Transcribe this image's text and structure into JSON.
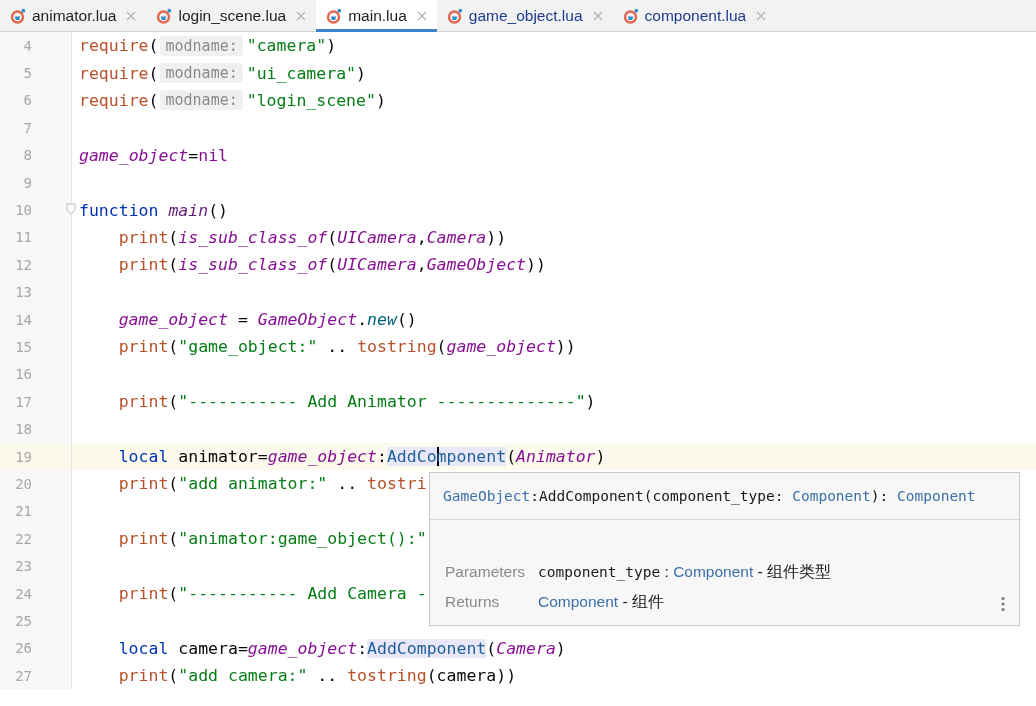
{
  "tabs": [
    {
      "label": "animator.lua",
      "selected": false,
      "color": "#1f1f1f"
    },
    {
      "label": "login_scene.lua",
      "selected": false,
      "color": "#1f1f1f"
    },
    {
      "label": "main.lua",
      "selected": true,
      "color": "#1f1f1f"
    },
    {
      "label": "game_object.lua",
      "selected": false,
      "color": "#1d3c8f"
    },
    {
      "label": "component.lua",
      "selected": false,
      "color": "#1d3c8f"
    }
  ],
  "lines": [
    {
      "number": "4",
      "current": false,
      "foldable": false,
      "indented": false,
      "tokens": [
        {
          "text": "require",
          "kind": "fn"
        },
        {
          "text": "(",
          "kind": "plain"
        },
        {
          "text": "modname:",
          "kind": "hint"
        },
        {
          "text": "\"camera\"",
          "kind": "str"
        },
        {
          "text": ")",
          "kind": "plain"
        }
      ]
    },
    {
      "number": "5",
      "current": false,
      "foldable": false,
      "indented": false,
      "tokens": [
        {
          "text": "require",
          "kind": "fn"
        },
        {
          "text": "(",
          "kind": "plain"
        },
        {
          "text": "modname:",
          "kind": "hint"
        },
        {
          "text": "\"ui_camera\"",
          "kind": "str"
        },
        {
          "text": ")",
          "kind": "plain"
        }
      ]
    },
    {
      "number": "6",
      "current": false,
      "foldable": false,
      "indented": false,
      "tokens": [
        {
          "text": "require",
          "kind": "fn"
        },
        {
          "text": "(",
          "kind": "plain"
        },
        {
          "text": "modname:",
          "kind": "hint"
        },
        {
          "text": "\"login_scene\"",
          "kind": "str"
        },
        {
          "text": ")",
          "kind": "plain"
        }
      ]
    },
    {
      "number": "7",
      "current": false,
      "foldable": false
    },
    {
      "number": "8",
      "current": false,
      "foldable": false,
      "indented": false,
      "tokens": [
        {
          "text": "game_object",
          "kind": "var"
        },
        {
          "text": "=",
          "kind": "plain"
        },
        {
          "text": "nil",
          "kind": "const"
        }
      ]
    },
    {
      "number": "9",
      "current": false,
      "foldable": false
    },
    {
      "number": "10",
      "current": false,
      "foldable": true,
      "indented": false,
      "tokens": [
        {
          "text": "function ",
          "kind": "kw"
        },
        {
          "text": "main",
          "kind": "name"
        },
        {
          "text": "()",
          "kind": "plain"
        }
      ]
    },
    {
      "number": "11",
      "current": false,
      "foldable": false,
      "indented": true,
      "tokens": [
        {
          "text": "print",
          "kind": "fn"
        },
        {
          "text": "(",
          "kind": "plain"
        },
        {
          "text": "is_sub_class_of",
          "kind": "var"
        },
        {
          "text": "(",
          "kind": "plain"
        },
        {
          "text": "UICamera",
          "kind": "var"
        },
        {
          "text": ",",
          "kind": "plain"
        },
        {
          "text": "Camera",
          "kind": "var"
        },
        {
          "text": "))",
          "kind": "plain"
        }
      ]
    },
    {
      "number": "12",
      "current": false,
      "foldable": false,
      "indented": true,
      "tokens": [
        {
          "text": "print",
          "kind": "fn"
        },
        {
          "text": "(",
          "kind": "plain"
        },
        {
          "text": "is_sub_class_of",
          "kind": "var"
        },
        {
          "text": "(",
          "kind": "plain"
        },
        {
          "text": "UICamera",
          "kind": "var"
        },
        {
          "text": ",",
          "kind": "plain"
        },
        {
          "text": "GameObject",
          "kind": "var"
        },
        {
          "text": "))",
          "kind": "plain"
        }
      ]
    },
    {
      "number": "13",
      "current": false,
      "foldable": false
    },
    {
      "number": "14",
      "current": false,
      "foldable": false,
      "indented": true,
      "tokens": [
        {
          "text": "game_object",
          "kind": "var"
        },
        {
          "text": " = ",
          "kind": "plain"
        },
        {
          "text": "GameObject",
          "kind": "var"
        },
        {
          "text": ".",
          "kind": "plain"
        },
        {
          "text": "new",
          "kind": "method"
        },
        {
          "text": "()",
          "kind": "plain"
        }
      ]
    },
    {
      "number": "15",
      "current": false,
      "foldable": false,
      "indented": true,
      "tokens": [
        {
          "text": "print",
          "kind": "fn"
        },
        {
          "text": "(",
          "kind": "plain"
        },
        {
          "text": "\"game_object:\"",
          "kind": "str"
        },
        {
          "text": " .. ",
          "kind": "plain"
        },
        {
          "text": "tostring",
          "kind": "fn"
        },
        {
          "text": "(",
          "kind": "plain"
        },
        {
          "text": "game_object",
          "kind": "var"
        },
        {
          "text": "))",
          "kind": "plain"
        }
      ]
    },
    {
      "number": "16",
      "current": false,
      "foldable": false
    },
    {
      "number": "17",
      "current": false,
      "foldable": false,
      "indented": true,
      "tokens": [
        {
          "text": "print",
          "kind": "fn"
        },
        {
          "text": "(",
          "kind": "plain"
        },
        {
          "text": "\"----------- Add Animator --------------\"",
          "kind": "str"
        },
        {
          "text": ")",
          "kind": "plain"
        }
      ]
    },
    {
      "number": "18",
      "current": false,
      "foldable": false
    },
    {
      "number": "19",
      "current": true,
      "foldable": false,
      "indented": true,
      "tokens": [
        {
          "text": "local",
          "kind": "kw"
        },
        {
          "text": " animator=",
          "kind": "plain"
        },
        {
          "text": "game_object",
          "kind": "var"
        },
        {
          "text": ":",
          "kind": "plain"
        },
        {
          "text": "AddCo",
          "kind": "hl"
        },
        {
          "text": "mponent",
          "kind": "hl",
          "cursor": true
        },
        {
          "text": "(",
          "kind": "plain"
        },
        {
          "text": "Animator",
          "kind": "var"
        },
        {
          "text": ")",
          "kind": "plain"
        }
      ]
    },
    {
      "number": "20",
      "current": false,
      "foldable": false,
      "indented": true,
      "tokens": [
        {
          "text": "print",
          "kind": "fn"
        },
        {
          "text": "(",
          "kind": "plain"
        },
        {
          "text": "\"add animator:\"",
          "kind": "str"
        },
        {
          "text": " .. ",
          "kind": "plain"
        },
        {
          "text": "tostri",
          "kind": "fn"
        }
      ]
    },
    {
      "number": "21",
      "current": false,
      "foldable": false
    },
    {
      "number": "22",
      "current": false,
      "foldable": false,
      "indented": true,
      "tokens": [
        {
          "text": "print",
          "kind": "fn"
        },
        {
          "text": "(",
          "kind": "plain"
        },
        {
          "text": "\"animator:game_object():\"",
          "kind": "str"
        }
      ]
    },
    {
      "number": "23",
      "current": false,
      "foldable": false
    },
    {
      "number": "24",
      "current": false,
      "foldable": false,
      "indented": true,
      "tokens": [
        {
          "text": "print",
          "kind": "fn"
        },
        {
          "text": "(",
          "kind": "plain"
        },
        {
          "text": "\"----------- Add Camera -",
          "kind": "str"
        }
      ]
    },
    {
      "number": "25",
      "current": false,
      "foldable": false
    },
    {
      "number": "26",
      "current": false,
      "foldable": false,
      "indented": true,
      "tokens": [
        {
          "text": "local",
          "kind": "kw"
        },
        {
          "text": " camera=",
          "kind": "plain"
        },
        {
          "text": "game_object",
          "kind": "var"
        },
        {
          "text": ":",
          "kind": "plain"
        },
        {
          "text": "AddComponent",
          "kind": "hl"
        },
        {
          "text": "(",
          "kind": "plain"
        },
        {
          "text": "Camera",
          "kind": "var"
        },
        {
          "text": ")",
          "kind": "plain"
        }
      ]
    },
    {
      "number": "27",
      "current": false,
      "foldable": false,
      "indented": true,
      "tokens": [
        {
          "text": "print",
          "kind": "fn"
        },
        {
          "text": "(",
          "kind": "plain"
        },
        {
          "text": "\"add camera:\"",
          "kind": "str"
        },
        {
          "text": " .. ",
          "kind": "plain"
        },
        {
          "text": "tostring",
          "kind": "fn"
        },
        {
          "text": "(camera))",
          "kind": "plain"
        }
      ]
    }
  ],
  "doc_popup": {
    "signature": [
      {
        "text": "GameObject",
        "kind": "type"
      },
      {
        "text": ":AddComponent(component_type: ",
        "kind": "plain"
      },
      {
        "text": "Component",
        "kind": "type"
      },
      {
        "text": "): ",
        "kind": "plain"
      },
      {
        "text": "Component",
        "kind": "type"
      }
    ],
    "sections": [
      {
        "label": "Parameters",
        "value": [
          {
            "text": "component_type",
            "kind": "mono"
          },
          {
            "text": " : ",
            "kind": "plain"
          },
          {
            "text": "Component",
            "kind": "type"
          },
          {
            "text": " - 组件类型",
            "kind": "plain"
          }
        ]
      },
      {
        "label": "Returns",
        "value": [
          {
            "text": "Component",
            "kind": "type"
          },
          {
            "text": " - 组件",
            "kind": "plain"
          }
        ]
      }
    ]
  }
}
